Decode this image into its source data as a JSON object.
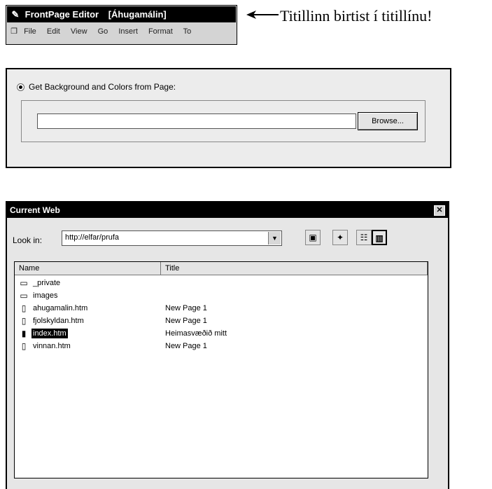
{
  "frontpage_snippet": {
    "icon": "frontpage-app-icon",
    "title": "FrontPage Editor",
    "document": "[Áhugamálin]",
    "menu": [
      "File",
      "Edit",
      "View",
      "Go",
      "Insert",
      "Format",
      "To"
    ]
  },
  "annotation": {
    "text": "Titillinn birtist í titillínu!"
  },
  "background_dialog": {
    "radio_label": "Get Background and Colors from Page:",
    "path_value": "",
    "browse_label": "Browse..."
  },
  "current_web": {
    "title": "Current Web",
    "close": "✕",
    "look_in_label": "Look in:",
    "look_in_value": "http://elfar/prufa",
    "toolbar": {
      "up_folder_icon": "up-folder-icon",
      "new_folder_icon": "new-folder-icon",
      "list_view_icon": "list-view-icon",
      "details_view_icon": "details-view-icon"
    },
    "columns": [
      "Name",
      "Title"
    ],
    "files": [
      {
        "name": "_private",
        "title": "",
        "type": "folder"
      },
      {
        "name": "images",
        "title": "",
        "type": "folder"
      },
      {
        "name": "ahugamalin.htm",
        "title": "New Page 1",
        "type": "file"
      },
      {
        "name": "fjolskyldan.htm",
        "title": "New Page 1",
        "type": "file"
      },
      {
        "name": "index.htm",
        "title": "Heimasvæðið mitt",
        "type": "file",
        "selected": true
      },
      {
        "name": "vinnan.htm",
        "title": "New Page 1",
        "type": "file"
      }
    ]
  }
}
